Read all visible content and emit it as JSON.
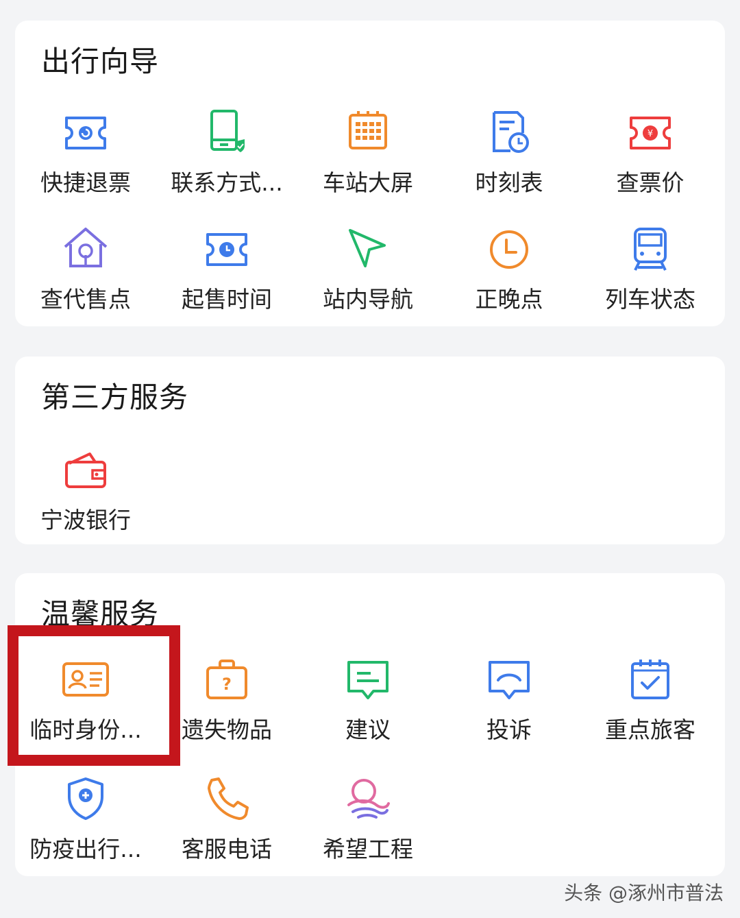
{
  "sections": [
    {
      "title": "出行向导",
      "items": [
        {
          "label": "快捷退票",
          "icon": "ticket-refund-icon"
        },
        {
          "label": "联系方式...",
          "icon": "phone-verified-icon"
        },
        {
          "label": "车站大屏",
          "icon": "station-screen-icon"
        },
        {
          "label": "时刻表",
          "icon": "timetable-icon"
        },
        {
          "label": "查票价",
          "icon": "ticket-price-icon"
        },
        {
          "label": "查代售点",
          "icon": "agency-house-icon"
        },
        {
          "label": "起售时间",
          "icon": "sale-time-ticket-icon"
        },
        {
          "label": "站内导航",
          "icon": "navigation-arrow-icon"
        },
        {
          "label": "正晚点",
          "icon": "clock-icon"
        },
        {
          "label": "列车状态",
          "icon": "train-icon"
        }
      ]
    },
    {
      "title": "第三方服务",
      "items": [
        {
          "label": "宁波银行",
          "icon": "wallet-icon"
        }
      ]
    },
    {
      "title": "温馨服务",
      "items": [
        {
          "label": "临时身份...",
          "icon": "id-card-icon"
        },
        {
          "label": "遗失物品",
          "icon": "lost-luggage-icon"
        },
        {
          "label": "建议",
          "icon": "suggestion-message-icon"
        },
        {
          "label": "投诉",
          "icon": "complaint-message-icon"
        },
        {
          "label": "重点旅客",
          "icon": "calendar-check-icon"
        },
        {
          "label": "防疫出行...",
          "icon": "shield-plus-icon"
        },
        {
          "label": "客服电话",
          "icon": "phone-icon"
        },
        {
          "label": "希望工程",
          "icon": "hope-project-icon"
        }
      ]
    }
  ],
  "watermark": "头条 @涿州市普法",
  "colors": {
    "blue": "#3e7bea",
    "green": "#22b86a",
    "orange": "#f08a2c",
    "red": "#ee3d3d",
    "purple": "#7a6fe0",
    "highlight": "#c4161c"
  }
}
